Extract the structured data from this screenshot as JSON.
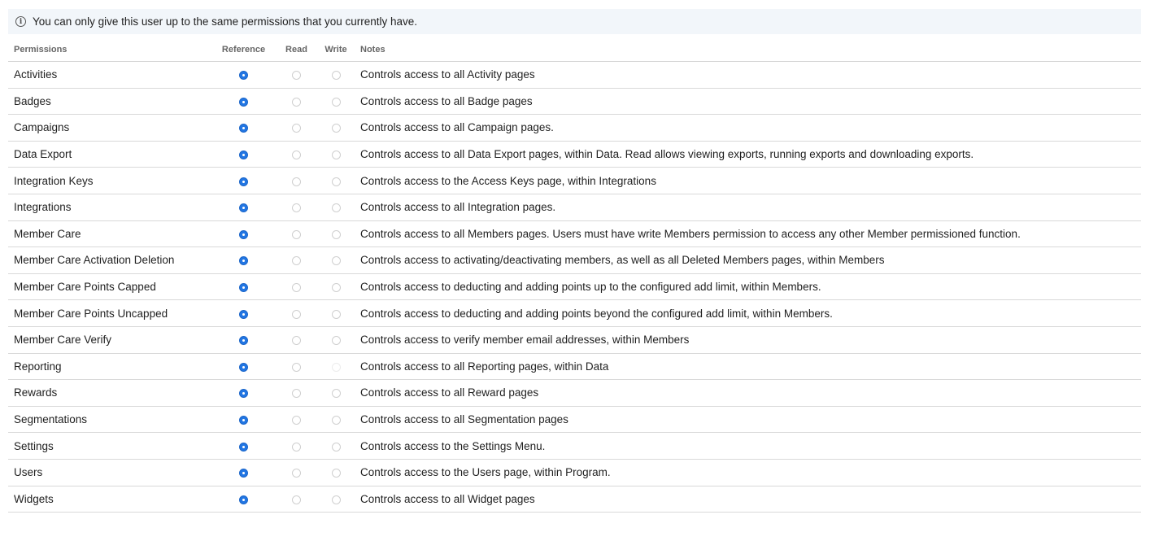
{
  "notice": {
    "icon": "info-icon",
    "text": "You can only give this user up to the same permissions that you currently have."
  },
  "table": {
    "headers": {
      "permissions": "Permissions",
      "reference": "Reference",
      "read": "Read",
      "write": "Write",
      "notes": "Notes"
    },
    "rows": [
      {
        "name": "Activities",
        "selected": "reference",
        "notes": "Controls access to all Activity pages"
      },
      {
        "name": "Badges",
        "selected": "reference",
        "notes": "Controls access to all Badge pages"
      },
      {
        "name": "Campaigns",
        "selected": "reference",
        "notes": "Controls access to all Campaign pages."
      },
      {
        "name": "Data Export",
        "selected": "reference",
        "notes": "Controls access to all Data Export pages, within Data. Read allows viewing exports, running exports and downloading exports."
      },
      {
        "name": "Integration Keys",
        "selected": "reference",
        "notes": "Controls access to the Access Keys page, within Integrations"
      },
      {
        "name": "Integrations",
        "selected": "reference",
        "notes": "Controls access to all Integration pages."
      },
      {
        "name": "Member Care",
        "selected": "reference",
        "notes": "Controls access to all Members pages. Users must have write Members permission to access any other Member permissioned function."
      },
      {
        "name": "Member Care Activation Deletion",
        "selected": "reference",
        "notes": "Controls access to activating/deactivating members, as well as all Deleted Members pages, within Members"
      },
      {
        "name": "Member Care Points Capped",
        "selected": "reference",
        "notes": "Controls access to deducting and adding points up to the configured add limit, within Members."
      },
      {
        "name": "Member Care Points Uncapped",
        "selected": "reference",
        "notes": "Controls access to deducting and adding points beyond the configured add limit, within Members."
      },
      {
        "name": "Member Care Verify",
        "selected": "reference",
        "notes": "Controls access to verify member email addresses, within Members"
      },
      {
        "name": "Reporting",
        "selected": "reference",
        "notes": "Controls access to all Reporting pages, within Data",
        "write_faint": true
      },
      {
        "name": "Rewards",
        "selected": "reference",
        "notes": "Controls access to all Reward pages"
      },
      {
        "name": "Segmentations",
        "selected": "reference",
        "notes": "Controls access to all Segmentation pages"
      },
      {
        "name": "Settings",
        "selected": "reference",
        "notes": "Controls access to the Settings Menu."
      },
      {
        "name": "Users",
        "selected": "reference",
        "notes": "Controls access to the Users page, within Program."
      },
      {
        "name": "Widgets",
        "selected": "reference",
        "notes": "Controls access to all Widget pages"
      }
    ]
  },
  "colors": {
    "accent": "#2276e3",
    "notice_bg": "#f2f6fa"
  }
}
